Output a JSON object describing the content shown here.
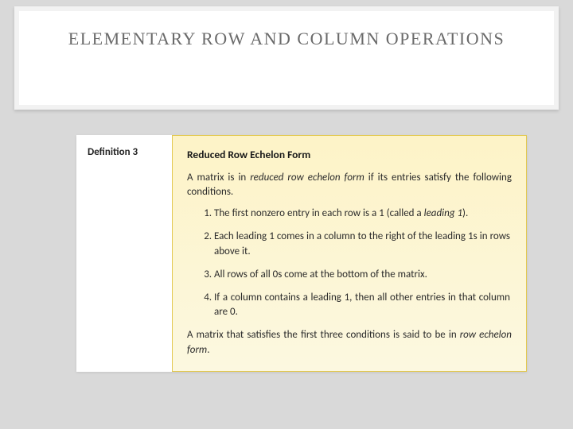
{
  "slide": {
    "title": "ELEMENTARY ROW AND COLUMN OPERATIONS"
  },
  "definition": {
    "label": "Definition 3",
    "title": "Reduced Row Echelon Form",
    "intro_pre": "A matrix is in ",
    "intro_em": "reduced row echelon form",
    "intro_post": " if its entries satisfy the following conditions.",
    "conditions": [
      {
        "pre": "The first nonzero entry in each row is a 1 (called a ",
        "em": "leading 1",
        "post": ")."
      },
      {
        "pre": "Each leading 1 comes in a column to the right of the leading 1s in rows above it.",
        "em": "",
        "post": ""
      },
      {
        "pre": "All rows of all 0s come at the bottom of the matrix.",
        "em": "",
        "post": ""
      },
      {
        "pre": "If a column contains a leading 1, then all other entries in that column are 0.",
        "em": "",
        "post": ""
      }
    ],
    "footer_pre": "A matrix that satisfies the first three conditions is said to be in ",
    "footer_em": "row echelon form",
    "footer_post": "."
  }
}
